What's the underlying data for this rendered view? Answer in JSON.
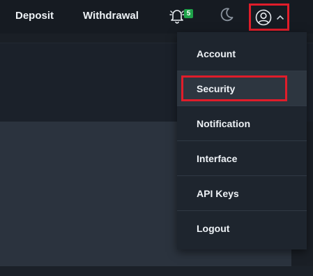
{
  "header": {
    "deposit_label": "Deposit",
    "withdrawal_label": "Withdrawal",
    "notifications": {
      "icon": "bell-icon",
      "count": "5",
      "badge_color": "#1fa24a"
    },
    "theme_toggle": {
      "icon": "moon-icon"
    },
    "profile": {
      "icon": "user-circle-icon",
      "chevron": "chevron-up-icon"
    }
  },
  "dropdown": {
    "items": [
      {
        "label": "Account"
      },
      {
        "label": "Security",
        "active": true
      },
      {
        "label": "Notification"
      },
      {
        "label": "Interface"
      },
      {
        "label": "API Keys"
      },
      {
        "label": "Logout"
      }
    ]
  },
  "colors": {
    "highlight": "#e01d2a",
    "topbar": "#161b22",
    "menu_bg": "#1e252e",
    "menu_active_bg": "#2d3640"
  }
}
